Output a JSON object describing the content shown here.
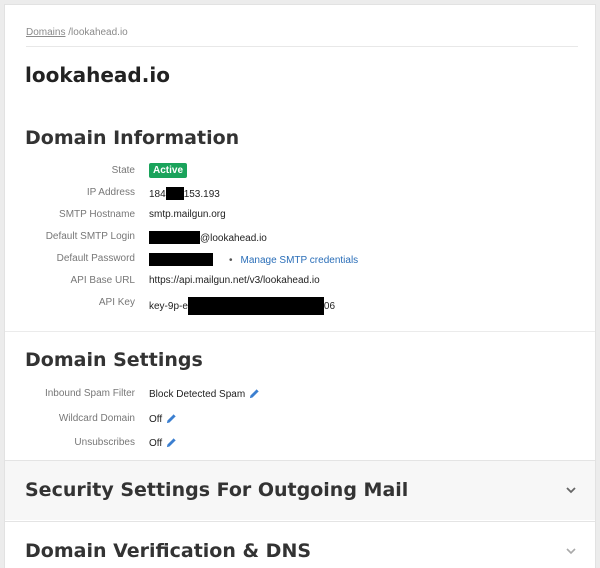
{
  "breadcrumb": {
    "root_label": "Domains",
    "separator": " /",
    "current": "lookahead.io"
  },
  "page_title": "lookahead.io",
  "domain_information": {
    "title": "Domain Information",
    "state": {
      "label": "State",
      "value": "Active"
    },
    "ip_address": {
      "label": "IP Address",
      "prefix": "184",
      "suffix": "153.193"
    },
    "smtp_hostname": {
      "label": "SMTP Hostname",
      "value": "smtp.mailgun.org"
    },
    "default_smtp_login": {
      "label": "Default SMTP Login",
      "suffix": "@lookahead.io"
    },
    "default_password": {
      "label": "Default Password",
      "bullet": "•",
      "link": "Manage SMTP credentials"
    },
    "api_base_url": {
      "label": "API Base URL",
      "value": "https://api.mailgun.net/v3/lookahead.io"
    },
    "api_key": {
      "label": "API Key",
      "prefix": "key-9p-e",
      "suffix": "06"
    }
  },
  "domain_settings": {
    "title": "Domain Settings",
    "inbound_spam_filter": {
      "label": "Inbound Spam Filter",
      "value": "Block Detected Spam"
    },
    "wildcard_domain": {
      "label": "Wildcard Domain",
      "value": "Off"
    },
    "unsubscribes": {
      "label": "Unsubscribes",
      "value": "Off"
    }
  },
  "panels": {
    "security": {
      "title": "Security Settings For Outgoing Mail"
    },
    "verification": {
      "title": "Domain Verification & DNS"
    }
  },
  "colors": {
    "active_badge": "#1aa35b",
    "link": "#2a6eb8",
    "pencil_icon": "#3b7fd0"
  },
  "icons": {
    "edit": "pencil-icon",
    "expand": "chevron-down-icon"
  }
}
